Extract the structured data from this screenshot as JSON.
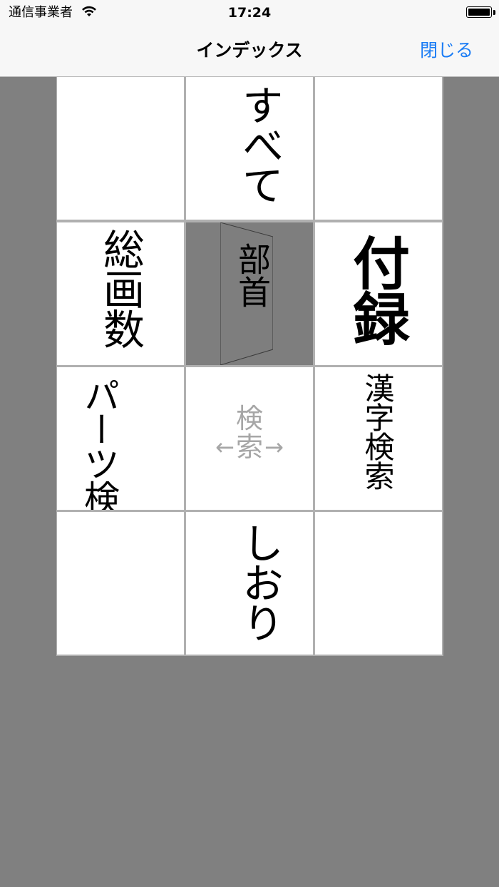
{
  "status_bar": {
    "carrier": "通信事業者",
    "time": "17:24"
  },
  "nav": {
    "title": "インデックス",
    "close_label": "閉じる"
  },
  "colors": {
    "background": "#808080",
    "accent": "#1a7cf5",
    "muted_text": "#a6a6a6",
    "selected_cell": "#7e7e7e"
  },
  "grid": {
    "all": "すべて",
    "stroke_count": "総画数",
    "radical": "部首",
    "appendix": "付録",
    "parts_search": "パーツ検索",
    "search_center": "検索",
    "arrow_left": "←",
    "arrow_right": "→",
    "kanji_search": "漢字検索",
    "bookmarks": "しおり"
  },
  "icons": [
    "wifi-icon",
    "battery-icon"
  ]
}
